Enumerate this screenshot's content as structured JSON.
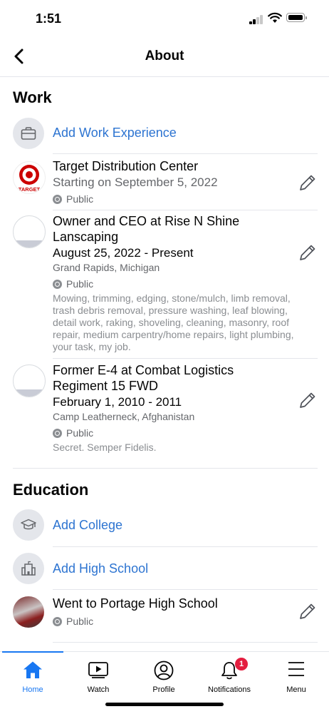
{
  "status_bar": {
    "time": "1:51"
  },
  "header": {
    "title": "About"
  },
  "work": {
    "section_title": "Work",
    "add_label": "Add Work Experience",
    "entries": [
      {
        "title": "Target Distribution Center",
        "subtitle": "Starting on September 5, 2022",
        "privacy": "Public",
        "logo_text": "TARGET"
      },
      {
        "title_line1": "Owner and CEO at Rise N Shine",
        "title_line2": "Lanscaping",
        "dates": "August 25, 2022 - Present",
        "location": "Grand Rapids, Michigan",
        "privacy": "Public",
        "description": "Mowing, trimming, edging, stone/mulch, limb removal, trash debris removal, pressure washing, leaf blowing, detail work, raking, shoveling, cleaning, masonry, roof repair, medium carpentry/home repairs, light plumbing, your task, my job."
      },
      {
        "title_line1": "Former E-4 at Combat Logistics",
        "title_line2": "Regiment 15 FWD",
        "dates": "February 1, 2010 - 2011",
        "location": "Camp Leatherneck, Afghanistan",
        "privacy": "Public",
        "description": "Secret. Semper Fidelis."
      }
    ]
  },
  "education": {
    "section_title": "Education",
    "add_college_label": "Add College",
    "add_high_school_label": "Add High School",
    "entries": [
      {
        "title": "Went to Portage High School",
        "privacy": "Public"
      }
    ]
  },
  "tab_bar": {
    "items": [
      {
        "label": "Home",
        "icon": "home-icon"
      },
      {
        "label": "Watch",
        "icon": "watch-icon"
      },
      {
        "label": "Profile",
        "icon": "profile-icon"
      },
      {
        "label": "Notifications",
        "icon": "bell-icon",
        "badge": "1"
      },
      {
        "label": "Menu",
        "icon": "menu-icon"
      }
    ]
  },
  "colors": {
    "accent": "#1877f2",
    "link": "#2d74d1",
    "badge": "#e41e3f"
  }
}
